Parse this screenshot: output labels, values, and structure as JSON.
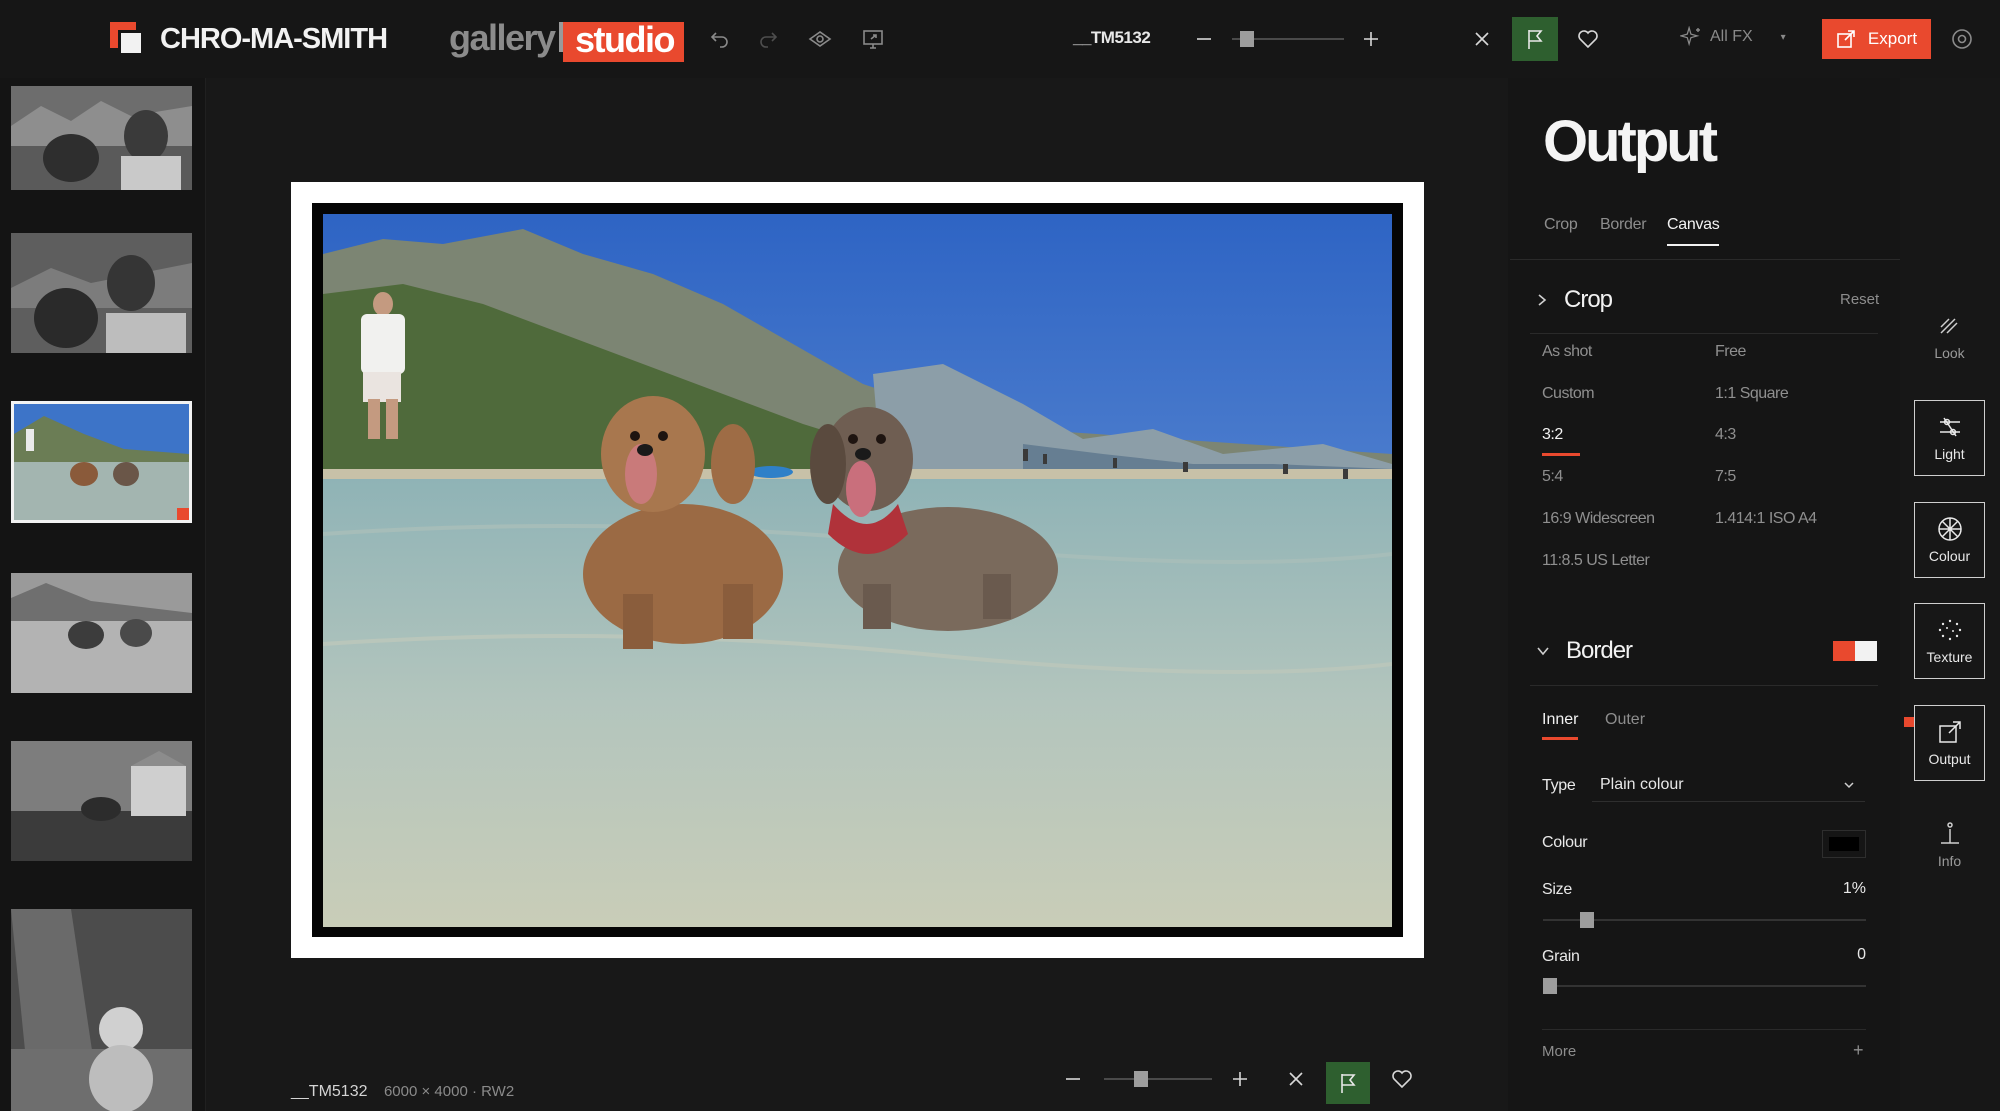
{
  "topbar": {
    "brand": "CHRO-MA-SMITH",
    "mode_gallery": "gallery",
    "mode_studio": "studio",
    "filename": "__TM5132",
    "zoom_level": 0.08,
    "allfx_label": "All FX",
    "export_label": "Export"
  },
  "filmstrip": {
    "items": [
      {
        "label": "thumbnail-1",
        "style": "bw-selfie"
      },
      {
        "label": "thumbnail-2",
        "style": "bw-selfie"
      },
      {
        "label": "thumbnail-3",
        "style": "color-lake",
        "selected": true
      },
      {
        "label": "thumbnail-4",
        "style": "bw-lake"
      },
      {
        "label": "thumbnail-5",
        "style": "bw-building"
      },
      {
        "label": "thumbnail-6",
        "style": "bw-dog"
      }
    ]
  },
  "canvas": {
    "filename": "__TM5132",
    "meta": "6000 × 4000 · RW2",
    "zoom_level": 0.32
  },
  "panel": {
    "title": "Output",
    "tabs": [
      {
        "label": "Crop",
        "active": false
      },
      {
        "label": "Border",
        "active": false
      },
      {
        "label": "Canvas",
        "active": true
      }
    ],
    "crop": {
      "title": "Crop",
      "reset_label": "Reset",
      "options": [
        {
          "label": "As shot"
        },
        {
          "label": "Free"
        },
        {
          "label": "Custom"
        },
        {
          "label": "1:1 Square"
        },
        {
          "label": "3:2",
          "active": true
        },
        {
          "label": "4:3"
        },
        {
          "label": "5:4"
        },
        {
          "label": "7:5"
        },
        {
          "label": "16:9 Widescreen"
        },
        {
          "label": "1.414:1 ISO A4"
        },
        {
          "label": "11:8.5 US Letter"
        }
      ]
    },
    "border": {
      "title": "Border",
      "subtabs": [
        {
          "label": "Inner",
          "active": true
        },
        {
          "label": "Outer",
          "active": false
        }
      ],
      "type_label": "Type",
      "type_value": "Plain colour",
      "colour_label": "Colour",
      "colour_value": "#000000",
      "size_label": "Size",
      "size_value": "1%",
      "size_level": 0.12,
      "grain_label": "Grain",
      "grain_value": "0",
      "grain_level": 0.0,
      "more_label": "More"
    }
  },
  "rail": {
    "items": [
      {
        "label": "Look",
        "icon": "look-icon"
      },
      {
        "label": "Light",
        "icon": "light-icon"
      },
      {
        "label": "Colour",
        "icon": "colour-icon"
      },
      {
        "label": "Texture",
        "icon": "texture-icon"
      },
      {
        "label": "Output",
        "icon": "output-icon",
        "active": true
      },
      {
        "label": "Info",
        "icon": "info-icon"
      }
    ]
  },
  "colors": {
    "accent": "#e9492e",
    "flag_active": "#2e5f2f",
    "background": "#171717"
  }
}
